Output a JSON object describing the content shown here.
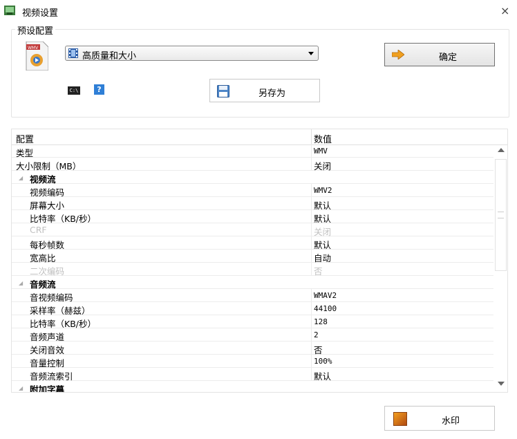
{
  "window": {
    "title": "视频设置",
    "close_glyph": "×"
  },
  "preset": {
    "group_label": "预设配置",
    "format_icon": "wmv-file-icon",
    "selected_value": "高质量和大小",
    "confirm_label": "确定",
    "cmd_icon_text": "C:\\",
    "help_icon_text": "?",
    "save_as_label": "另存为"
  },
  "grid": {
    "headers": {
      "name": "配置",
      "value": "数值"
    },
    "rows": [
      {
        "name": "类型",
        "value": "WMV",
        "type": "top"
      },
      {
        "name": "大小限制（MB）",
        "value": "关闭",
        "type": "top",
        "cjk": true
      },
      {
        "name": "视频流",
        "type": "category"
      },
      {
        "name": "视频编码",
        "value": "WMV2",
        "type": "child"
      },
      {
        "name": "屏幕大小",
        "value": "默认",
        "type": "child",
        "cjk": true
      },
      {
        "name": "比特率（KB/秒）",
        "value": "默认",
        "type": "child",
        "cjk": true
      },
      {
        "name": "CRF",
        "value": "关闭",
        "type": "child",
        "disabled": true,
        "cjk": true
      },
      {
        "name": "每秒帧数",
        "value": "默认",
        "type": "child",
        "cjk": true
      },
      {
        "name": "宽高比",
        "value": "自动",
        "type": "child",
        "cjk": true
      },
      {
        "name": "二次编码",
        "value": "否",
        "type": "child",
        "disabled": true,
        "cjk": true
      },
      {
        "name": "音频流",
        "type": "category"
      },
      {
        "name": "音视频编码",
        "value": "WMAV2",
        "type": "child"
      },
      {
        "name": "采样率（赫兹）",
        "value": "44100",
        "type": "child"
      },
      {
        "name": "比特率（KB/秒）",
        "value": "128",
        "type": "child"
      },
      {
        "name": "音频声道",
        "value": "2",
        "type": "child"
      },
      {
        "name": "关闭音效",
        "value": "否",
        "type": "child",
        "cjk": true
      },
      {
        "name": "音量控制",
        "value": "100%",
        "type": "child"
      },
      {
        "name": "音频流索引",
        "value": "默认",
        "type": "child",
        "cjk": true
      },
      {
        "name": "附加字幕",
        "type": "category"
      }
    ]
  },
  "watermark": {
    "label": "水印"
  },
  "colors": {
    "help_blue": "#2f7fd6",
    "ok_arrow": "#f0a020",
    "disabled_text": "#c0c0c0"
  }
}
